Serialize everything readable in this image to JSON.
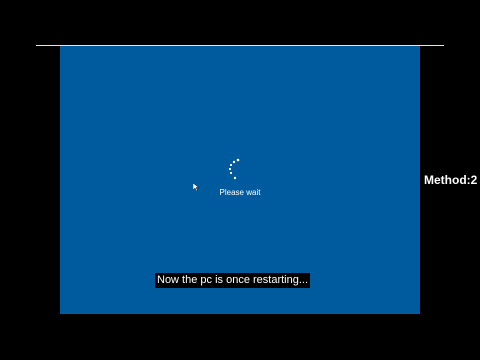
{
  "screen": {
    "status_text": "Please wait",
    "background_color": "#005a9e",
    "spinner_icon": "loading-dots-icon",
    "cursor_icon": "mouse-pointer-icon"
  },
  "overlay": {
    "caption": "Now the pc is once restarting...",
    "side_label": "Method:2"
  }
}
